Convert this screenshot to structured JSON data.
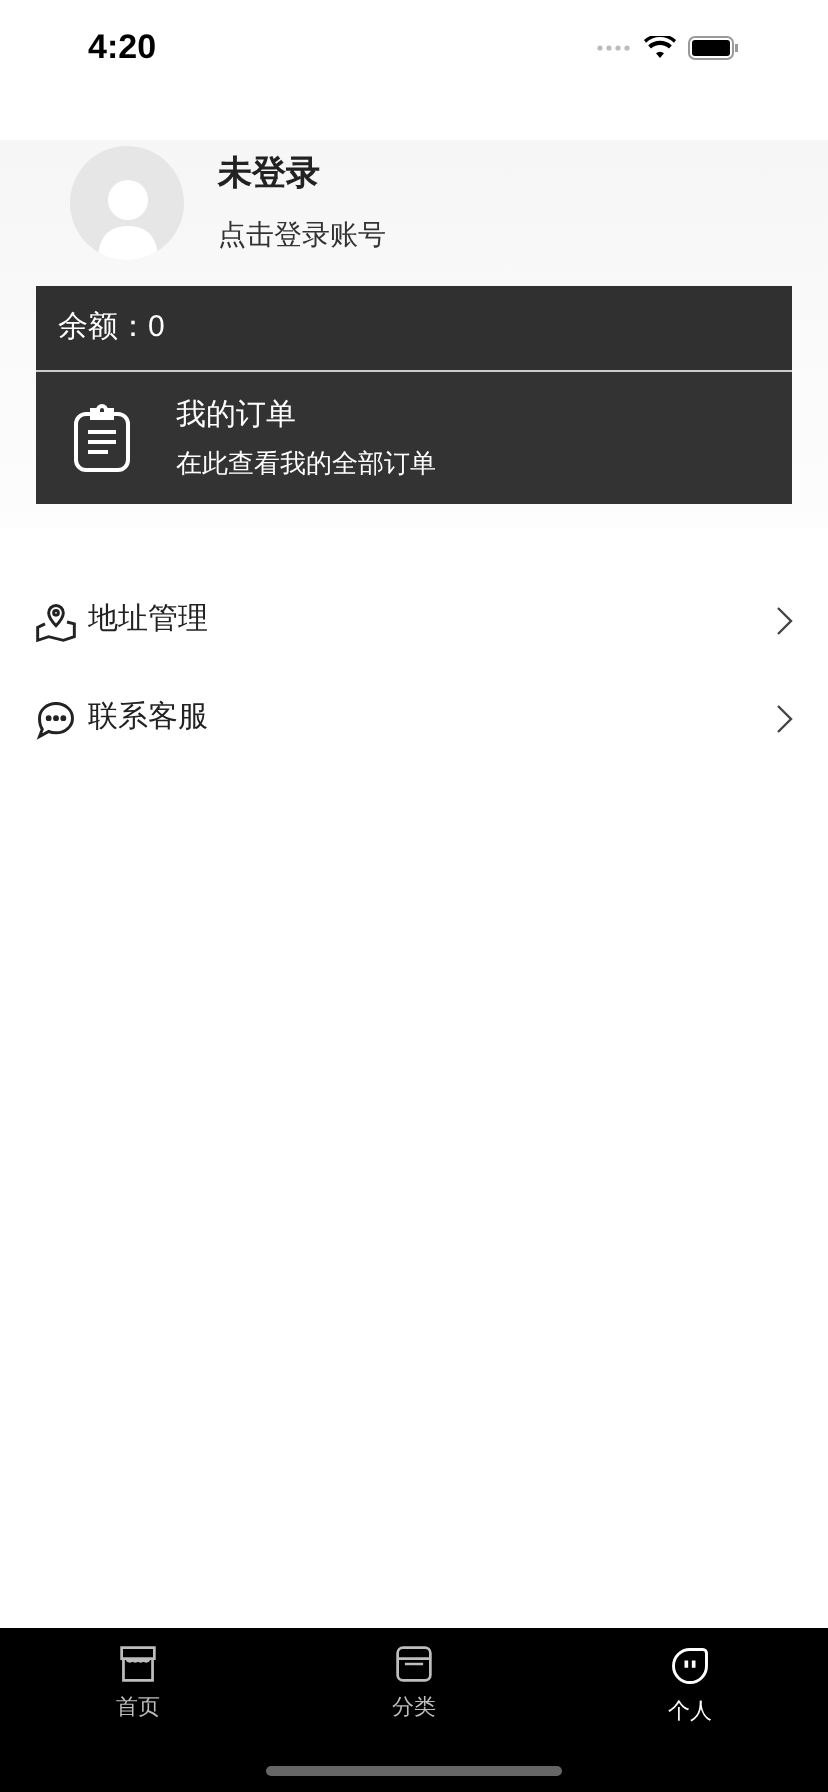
{
  "status_bar": {
    "time": "4:20"
  },
  "profile": {
    "name": "未登录",
    "subtitle": "点击登录账号"
  },
  "balance": {
    "label": "余额：0"
  },
  "orders": {
    "title": "我的订单",
    "subtitle": "在此查看我的全部订单"
  },
  "menu": [
    {
      "kind": "address",
      "label": "地址管理"
    },
    {
      "kind": "service",
      "label": "联系客服"
    }
  ],
  "tabs": [
    {
      "kind": "home",
      "label": "首页",
      "selected": false
    },
    {
      "kind": "category",
      "label": "分类",
      "selected": false
    },
    {
      "kind": "profile",
      "label": "个人",
      "selected": true
    }
  ]
}
